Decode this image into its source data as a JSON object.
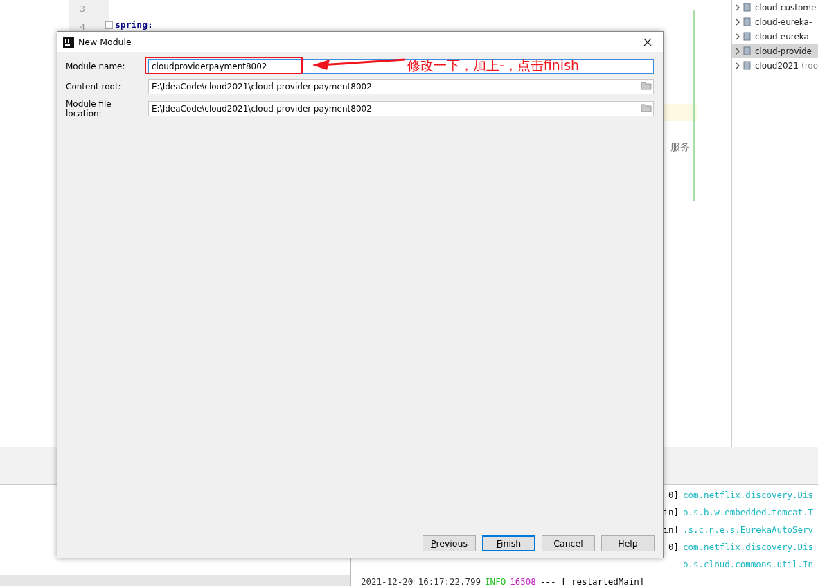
{
  "editor": {
    "line_numbers": [
      "3",
      "4"
    ],
    "code_line": "spring:",
    "comment_fragment": "服务"
  },
  "project_tree": {
    "items": [
      {
        "label": "cloud-custome",
        "selected": false
      },
      {
        "label": "cloud-eureka-",
        "selected": false
      },
      {
        "label": "cloud-eureka-",
        "selected": false
      },
      {
        "label": "cloud-provide",
        "selected": true
      },
      {
        "label": "cloud2021",
        "suffix": "(roo",
        "selected": false
      }
    ]
  },
  "console": {
    "lines": [
      {
        "kind": "tail",
        "thread": "0]",
        "logger": "com.netflix.discovery.Dis"
      },
      {
        "kind": "tail",
        "thread": "in]",
        "logger": "o.s.b.w.embedded.tomcat.T"
      },
      {
        "kind": "tail",
        "thread": "in]",
        "logger": ".s.c.n.e.s.EurekaAutoServ"
      },
      {
        "kind": "tail",
        "thread": "0]",
        "logger": "com.netflix.discovery.Dis"
      },
      {
        "kind": "tail",
        "logger": "o.s.cloud.commons.util.In"
      },
      {
        "kind": "full",
        "time": "2021-12-20 16:17:22.799",
        "level": "INFO",
        "pid": "16508",
        "thread": "--- [  restartedMain]"
      }
    ]
  },
  "dialog": {
    "title": "New Module",
    "fields": [
      {
        "label": "Module name:",
        "value": "cloudproviderpayment8002",
        "focused": true,
        "browse": false
      },
      {
        "label": "Content root:",
        "value": "E:\\IdeaCode\\cloud2021\\cloud-provider-payment8002",
        "focused": false,
        "browse": true
      },
      {
        "label": "Module file location:",
        "value": "E:\\IdeaCode\\cloud2021\\cloud-provider-payment8002",
        "focused": false,
        "browse": true
      }
    ],
    "buttons": [
      {
        "label": "Previous",
        "default": false
      },
      {
        "label": "Finish",
        "default": true
      },
      {
        "label": "Cancel",
        "default": false
      },
      {
        "label": "Help",
        "default": false
      }
    ]
  },
  "annotation": {
    "text": "修改一下，加上-，点击finish"
  }
}
